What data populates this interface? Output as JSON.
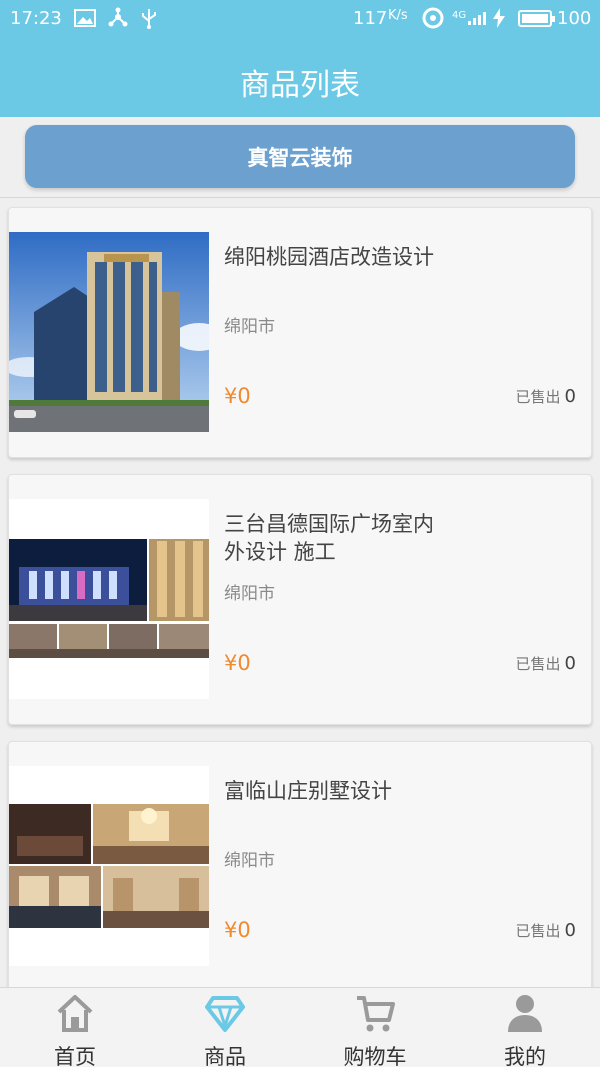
{
  "status_bar": {
    "time": "17:23",
    "speed": "117",
    "speed_unit": "K/s",
    "network": "4G",
    "battery": "100"
  },
  "header": {
    "title": "商品列表"
  },
  "brand_button": {
    "label": "真智云装饰"
  },
  "products": [
    {
      "title": "绵阳桃园酒店改造设计",
      "city": "绵阳市",
      "price": "¥0",
      "sold_label": "已售出",
      "sold_count": "0"
    },
    {
      "title": "三台昌德国际广场室内外设计 施工",
      "city": "绵阳市",
      "price": "¥0",
      "sold_label": "已售出",
      "sold_count": "0"
    },
    {
      "title": "富临山庄别墅设计",
      "city": "绵阳市",
      "price": "¥0",
      "sold_label": "已售出",
      "sold_count": "0"
    }
  ],
  "tabs": [
    {
      "label": "首页",
      "icon": "home-icon"
    },
    {
      "label": "商品",
      "icon": "diamond-icon",
      "active": true
    },
    {
      "label": "购物车",
      "icon": "cart-icon"
    },
    {
      "label": "我的",
      "icon": "user-icon"
    }
  ],
  "colors": {
    "header": "#6cc9e6",
    "brand_button": "#6ca0cf",
    "price": "#f08a2f",
    "tab_active": "#6cc9e6",
    "tab_inactive": "#9a9a9a"
  }
}
